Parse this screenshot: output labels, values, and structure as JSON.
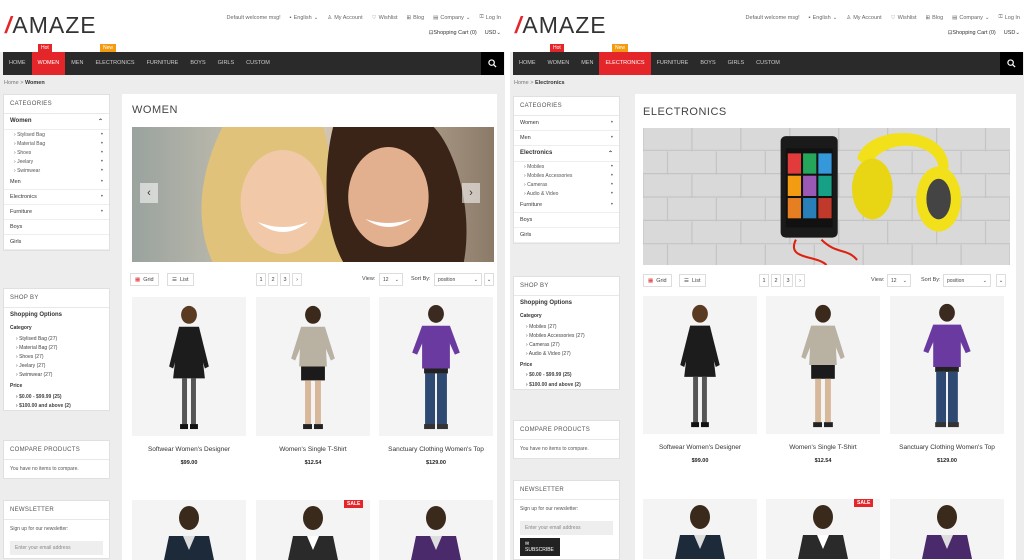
{
  "colors": {
    "accent": "#e4252a",
    "new_badge": "#f39c12",
    "nav_bg": "#2a2a2a"
  },
  "header": {
    "logo": "AMAZE",
    "welcome": "Default welcome msg!",
    "language": "English",
    "links": [
      "My Account",
      "Wishlist",
      "Blog",
      "Company",
      "Log In"
    ],
    "cart": "Shopping Cart (0)",
    "currency": "USD",
    "badges": {
      "hot": "Hot",
      "new": "New"
    }
  },
  "nav": {
    "items": [
      "HOME",
      "WOMEN",
      "MEN",
      "ELECTRONICS",
      "FURNITURE",
      "BOYS",
      "GIRLS",
      "CUSTOM"
    ]
  },
  "views": [
    {
      "breadcrumb": {
        "home": "Home",
        "current": "Women"
      },
      "page_title": "WOMEN",
      "categories": {
        "title": "CATEGORIES",
        "items": [
          {
            "label": "Women",
            "open": true,
            "subs": [
              "Stylised Bag",
              "Material Bag",
              "Shoes",
              "Jeelary",
              "Swimwear"
            ]
          },
          {
            "label": "Men"
          },
          {
            "label": "Electronics"
          },
          {
            "label": "Furniture"
          },
          {
            "label": "Boys"
          },
          {
            "label": "Girls"
          }
        ]
      },
      "shop_by": {
        "title": "SHOP BY",
        "options_title": "Shopping Options",
        "category_label": "Category",
        "category_options": [
          "Stylised Bag (27)",
          "Material Bag (27)",
          "Shoes (27)",
          "Jeelary (27)",
          "Swimwear (27)"
        ],
        "price_label": "Price",
        "price_options": [
          "$0.00 - $99.99 (25)",
          "$100.00 and above (2)"
        ]
      }
    },
    {
      "breadcrumb": {
        "home": "Home",
        "current": "Electronics"
      },
      "page_title": "ELECTRONICS",
      "categories": {
        "title": "CATEGORIES",
        "items": [
          {
            "label": "Women"
          },
          {
            "label": "Men"
          },
          {
            "label": "Electronics",
            "open": true,
            "subs": [
              "Mobiles",
              "Mobiles Accessories",
              "Cameras",
              "Audio & Video"
            ]
          },
          {
            "label": "Furniture"
          },
          {
            "label": "Boys"
          },
          {
            "label": "Girls"
          }
        ]
      },
      "shop_by": {
        "title": "SHOP BY",
        "options_title": "Shopping Options",
        "category_label": "Category",
        "category_options": [
          "Mobiles (27)",
          "Mobiles Accessories (27)",
          "Cameras (27)",
          "Audio & Video (27)"
        ],
        "price_label": "Price",
        "price_options": [
          "$0.00 - $99.99 (25)",
          "$100.00 and above (2)"
        ]
      }
    }
  ],
  "compare": {
    "title": "COMPARE PRODUCTS",
    "empty": "You have no items to compare."
  },
  "newsletter": {
    "title": "NEWSLETTER",
    "text": "Sign up for our newsletter:",
    "placeholder": "Enter your email address",
    "button": "SUBSCRIBE"
  },
  "toolbar": {
    "grid": "Grid",
    "list": "List",
    "pages": [
      "1",
      "2",
      "3"
    ],
    "next": "›",
    "view_label": "View:",
    "view_value": "12",
    "sort_label": "Sort By:",
    "sort_value": "position"
  },
  "products": [
    {
      "name": "Softwear Women's Designer",
      "price": "$99.00"
    },
    {
      "name": "Women's Single T-Shirt",
      "price": "$12.54"
    },
    {
      "name": "Sanctuary Clothing Women's Top",
      "price": "$129.00"
    }
  ],
  "sale_badge": "SALE"
}
